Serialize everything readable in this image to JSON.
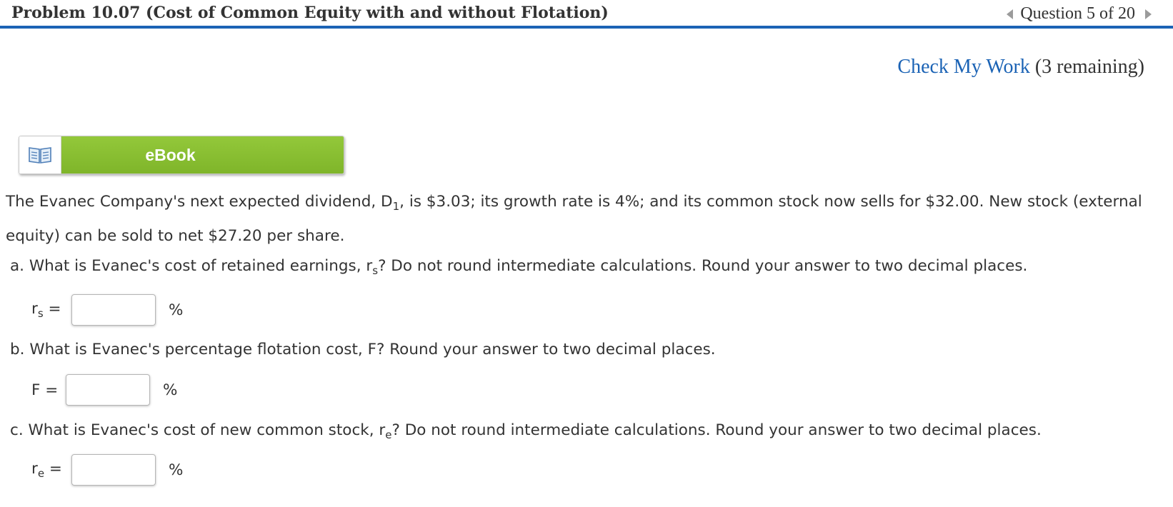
{
  "header": {
    "title": "Problem 10.07 (Cost of Common Equity with and without Flotation)",
    "question_nav": "Question 5 of 20"
  },
  "check_work": {
    "link_label": "Check My Work",
    "remaining": "(3 remaining)"
  },
  "ebook": {
    "label": "eBook",
    "icon": "book-icon"
  },
  "problem": {
    "text_before_sub": "The Evanec Company's next expected dividend, D",
    "sub": "1",
    "text_after_sub": ", is $3.03; its growth rate is 4%; and its common stock now sells for $32.00. New stock (external equity) can be sold to net $27.20 per share."
  },
  "questions": {
    "a": {
      "prefix": "a. What is Evanec's cost of retained earnings, r",
      "sub": "s",
      "suffix": "? Do not round intermediate calculations. Round your answer to two decimal places.",
      "var": "r",
      "var_sub": "s",
      "equals": " =",
      "value": "",
      "unit": "%"
    },
    "b": {
      "prefix": "b. What is Evanec's percentage flotation cost, F? Round your answer to two decimal places.",
      "var": "F =",
      "value": "",
      "unit": "%"
    },
    "c": {
      "prefix": "c. What is Evanec's cost of new common stock, r",
      "sub": "e",
      "suffix": "? Do not round intermediate calculations. Round your answer to two decimal places.",
      "var": "r",
      "var_sub": "e",
      "equals": " =",
      "value": "",
      "unit": "%"
    }
  },
  "colors": {
    "accent_blue": "#1b63b5",
    "ebook_green": "#8bc034",
    "text": "#333333"
  }
}
